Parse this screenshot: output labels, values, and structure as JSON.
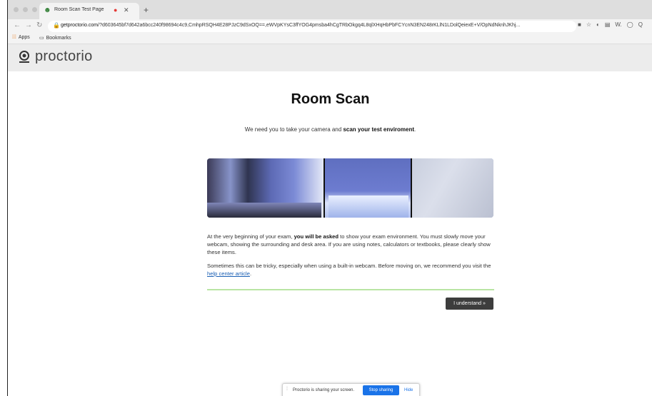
{
  "browser": {
    "tab_title": "Room Scan Test Page",
    "new_tab": "+",
    "url_host": "getproctorio.com",
    "url_rest": "/?d603645bf7d642a6bcc240f98694c4c9,CmhpRSQH4E28PJzC9dSxOQ==,eWVpKYsC3ffYOG4pmsba4hCgTRbOkgq4L8qlXHqHbPbFCYcnN3EN248rKLlN1LDolQeiexE+V/OpNdNknhJKhj...",
    "bookmarks": [
      {
        "label": "Apps",
        "icon": "apps-grid-icon"
      },
      {
        "label": "Bookmarks",
        "icon": "folder-icon"
      }
    ],
    "toolbar_glyphs": [
      "■",
      "☆",
      "◐",
      "▤",
      "W.",
      "◯",
      "Q"
    ]
  },
  "header": {
    "brand": "proctorio"
  },
  "main": {
    "title": "Room Scan",
    "subtitle_pre": "We need you to take your camera and ",
    "subtitle_bold": "scan your test enviroment",
    "subtitle_post": ".",
    "para1_pre": "At the very beginning of your exam, ",
    "para1_bold": "you will be asked",
    "para1_post": " to show your exam environment. You must slowly move your webcam, showing the surrounding and desk area. If you are using notes, calculators or textbooks, please clearly show these items.",
    "para2_pre": "Sometimes this can be tricky, especially when using a built-in webcam. Before moving on, we recommend you visit the ",
    "para2_link": "help center article",
    "para2_post": ".",
    "button": "I understand »"
  },
  "share_bar": {
    "message": "Proctorio is sharing your screen.",
    "stop": "Stop sharing",
    "hide": "Hide"
  },
  "colors": {
    "accent_blue": "#1a73e8",
    "divider_green": "#b9e5a3",
    "button_dark": "#3d3d3d"
  }
}
